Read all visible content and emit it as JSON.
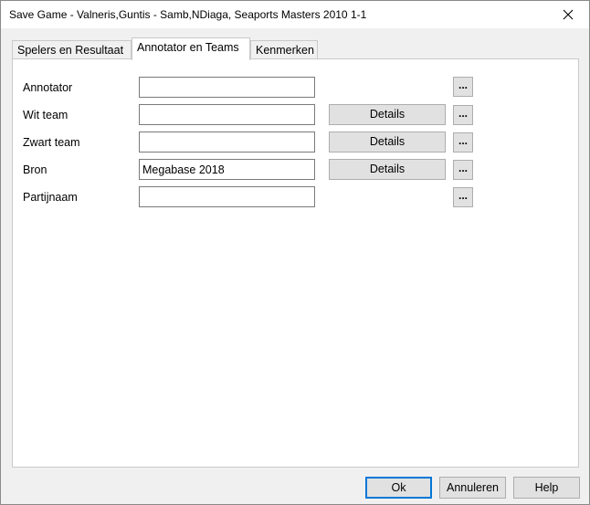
{
  "window": {
    "title": "Save Game - Valneris,Guntis - Samb,NDiaga, Seaports Masters 2010 1-1"
  },
  "tabs": [
    {
      "label": "Spelers en Resultaat",
      "active": false
    },
    {
      "label": "Annotator en Teams",
      "active": true
    },
    {
      "label": "Kenmerken",
      "active": false
    }
  ],
  "form": {
    "annotator": {
      "label": "Annotator",
      "value": ""
    },
    "wit_team": {
      "label": "Wit team",
      "value": "",
      "details_label": "Details"
    },
    "zwart_team": {
      "label": "Zwart team",
      "value": "",
      "details_label": "Details"
    },
    "bron": {
      "label": "Bron",
      "value": "Megabase 2018",
      "details_label": "Details"
    },
    "partijnaam": {
      "label": "Partijnaam",
      "value": ""
    },
    "browse_label": "..."
  },
  "buttons": {
    "ok": "Ok",
    "cancel": "Annuleren",
    "help": "Help"
  }
}
